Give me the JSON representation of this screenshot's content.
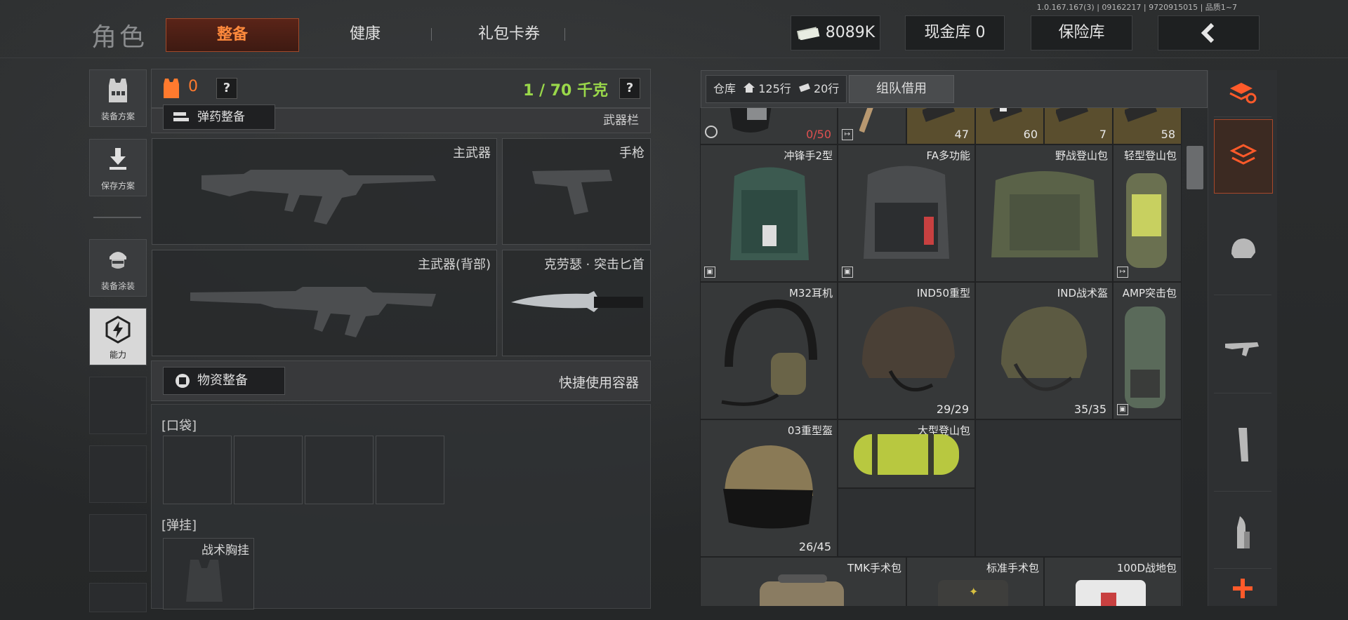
{
  "header": {
    "title": "角色",
    "tabs": [
      "整备",
      "健康",
      "礼包卡券"
    ],
    "version": "1.0.167.167(3) | 09162217 | 9720915015 | 品质1~7",
    "money": "8089K",
    "cash_vault": "现金库 0",
    "safe_box": "保险库"
  },
  "sidebar": {
    "items": [
      {
        "label": "装备方案",
        "icon": "vest-icon"
      },
      {
        "label": "保存方案",
        "icon": "download-icon"
      },
      {
        "label": "装备涂装",
        "icon": "soldier-icon"
      },
      {
        "label": "能力",
        "icon": "ability-icon"
      }
    ]
  },
  "equipment": {
    "armor_count": "0",
    "help": "?",
    "weight": "1 / 70 千克",
    "ammo_section": "弹药整备",
    "weapon_rack": "武器栏",
    "slots": {
      "primary": "主武器",
      "pistol": "手枪",
      "primary_back": "主武器(背部)",
      "knife": "克劳瑟 · 突击匕首"
    },
    "supply_section": "物资整备",
    "quick_container": "快捷使用容器",
    "pockets_label": "[口袋]",
    "rig_label": "[弹挂]",
    "rig_name": "战术胸挂"
  },
  "storage": {
    "label": "仓库",
    "rows_home": "125行",
    "rows_other": "20行",
    "team_borrow": "组队借用",
    "top_row": [
      {
        "name": "",
        "count": "0/50",
        "count_color": "#e05050"
      },
      {
        "name": "",
        "count": ""
      },
      {
        "name": "",
        "count": "47"
      },
      {
        "name": "",
        "count": "60"
      },
      {
        "name": "",
        "count": "7"
      },
      {
        "name": "",
        "count": "58"
      }
    ],
    "items": [
      {
        "name": "冲锋手2型",
        "count": ""
      },
      {
        "name": "FA多功能",
        "count": ""
      },
      {
        "name": "野战登山包",
        "count": ""
      },
      {
        "name": "轻型登山包",
        "count": ""
      },
      {
        "name": "M32耳机",
        "count": ""
      },
      {
        "name": "IND50重型",
        "count": "29/29"
      },
      {
        "name": "IND战术盔",
        "count": "35/35"
      },
      {
        "name": "AMP突击包",
        "count": ""
      },
      {
        "name": "03重型盔",
        "count": "26/45"
      },
      {
        "name": "大型登山包",
        "count": ""
      },
      {
        "name": "TMK手术包",
        "count": ""
      },
      {
        "name": "标准手术包",
        "count": ""
      },
      {
        "name": "100D战地包",
        "count": ""
      }
    ]
  },
  "right_rail": [
    "layers-refresh-icon",
    "layers-icon",
    "helmet-icon",
    "rifle-icon",
    "magazine-icon",
    "bullet-icon",
    "plus-icon"
  ],
  "colors": {
    "accent": "#ff8a3c",
    "weight": "#9ad84a"
  }
}
